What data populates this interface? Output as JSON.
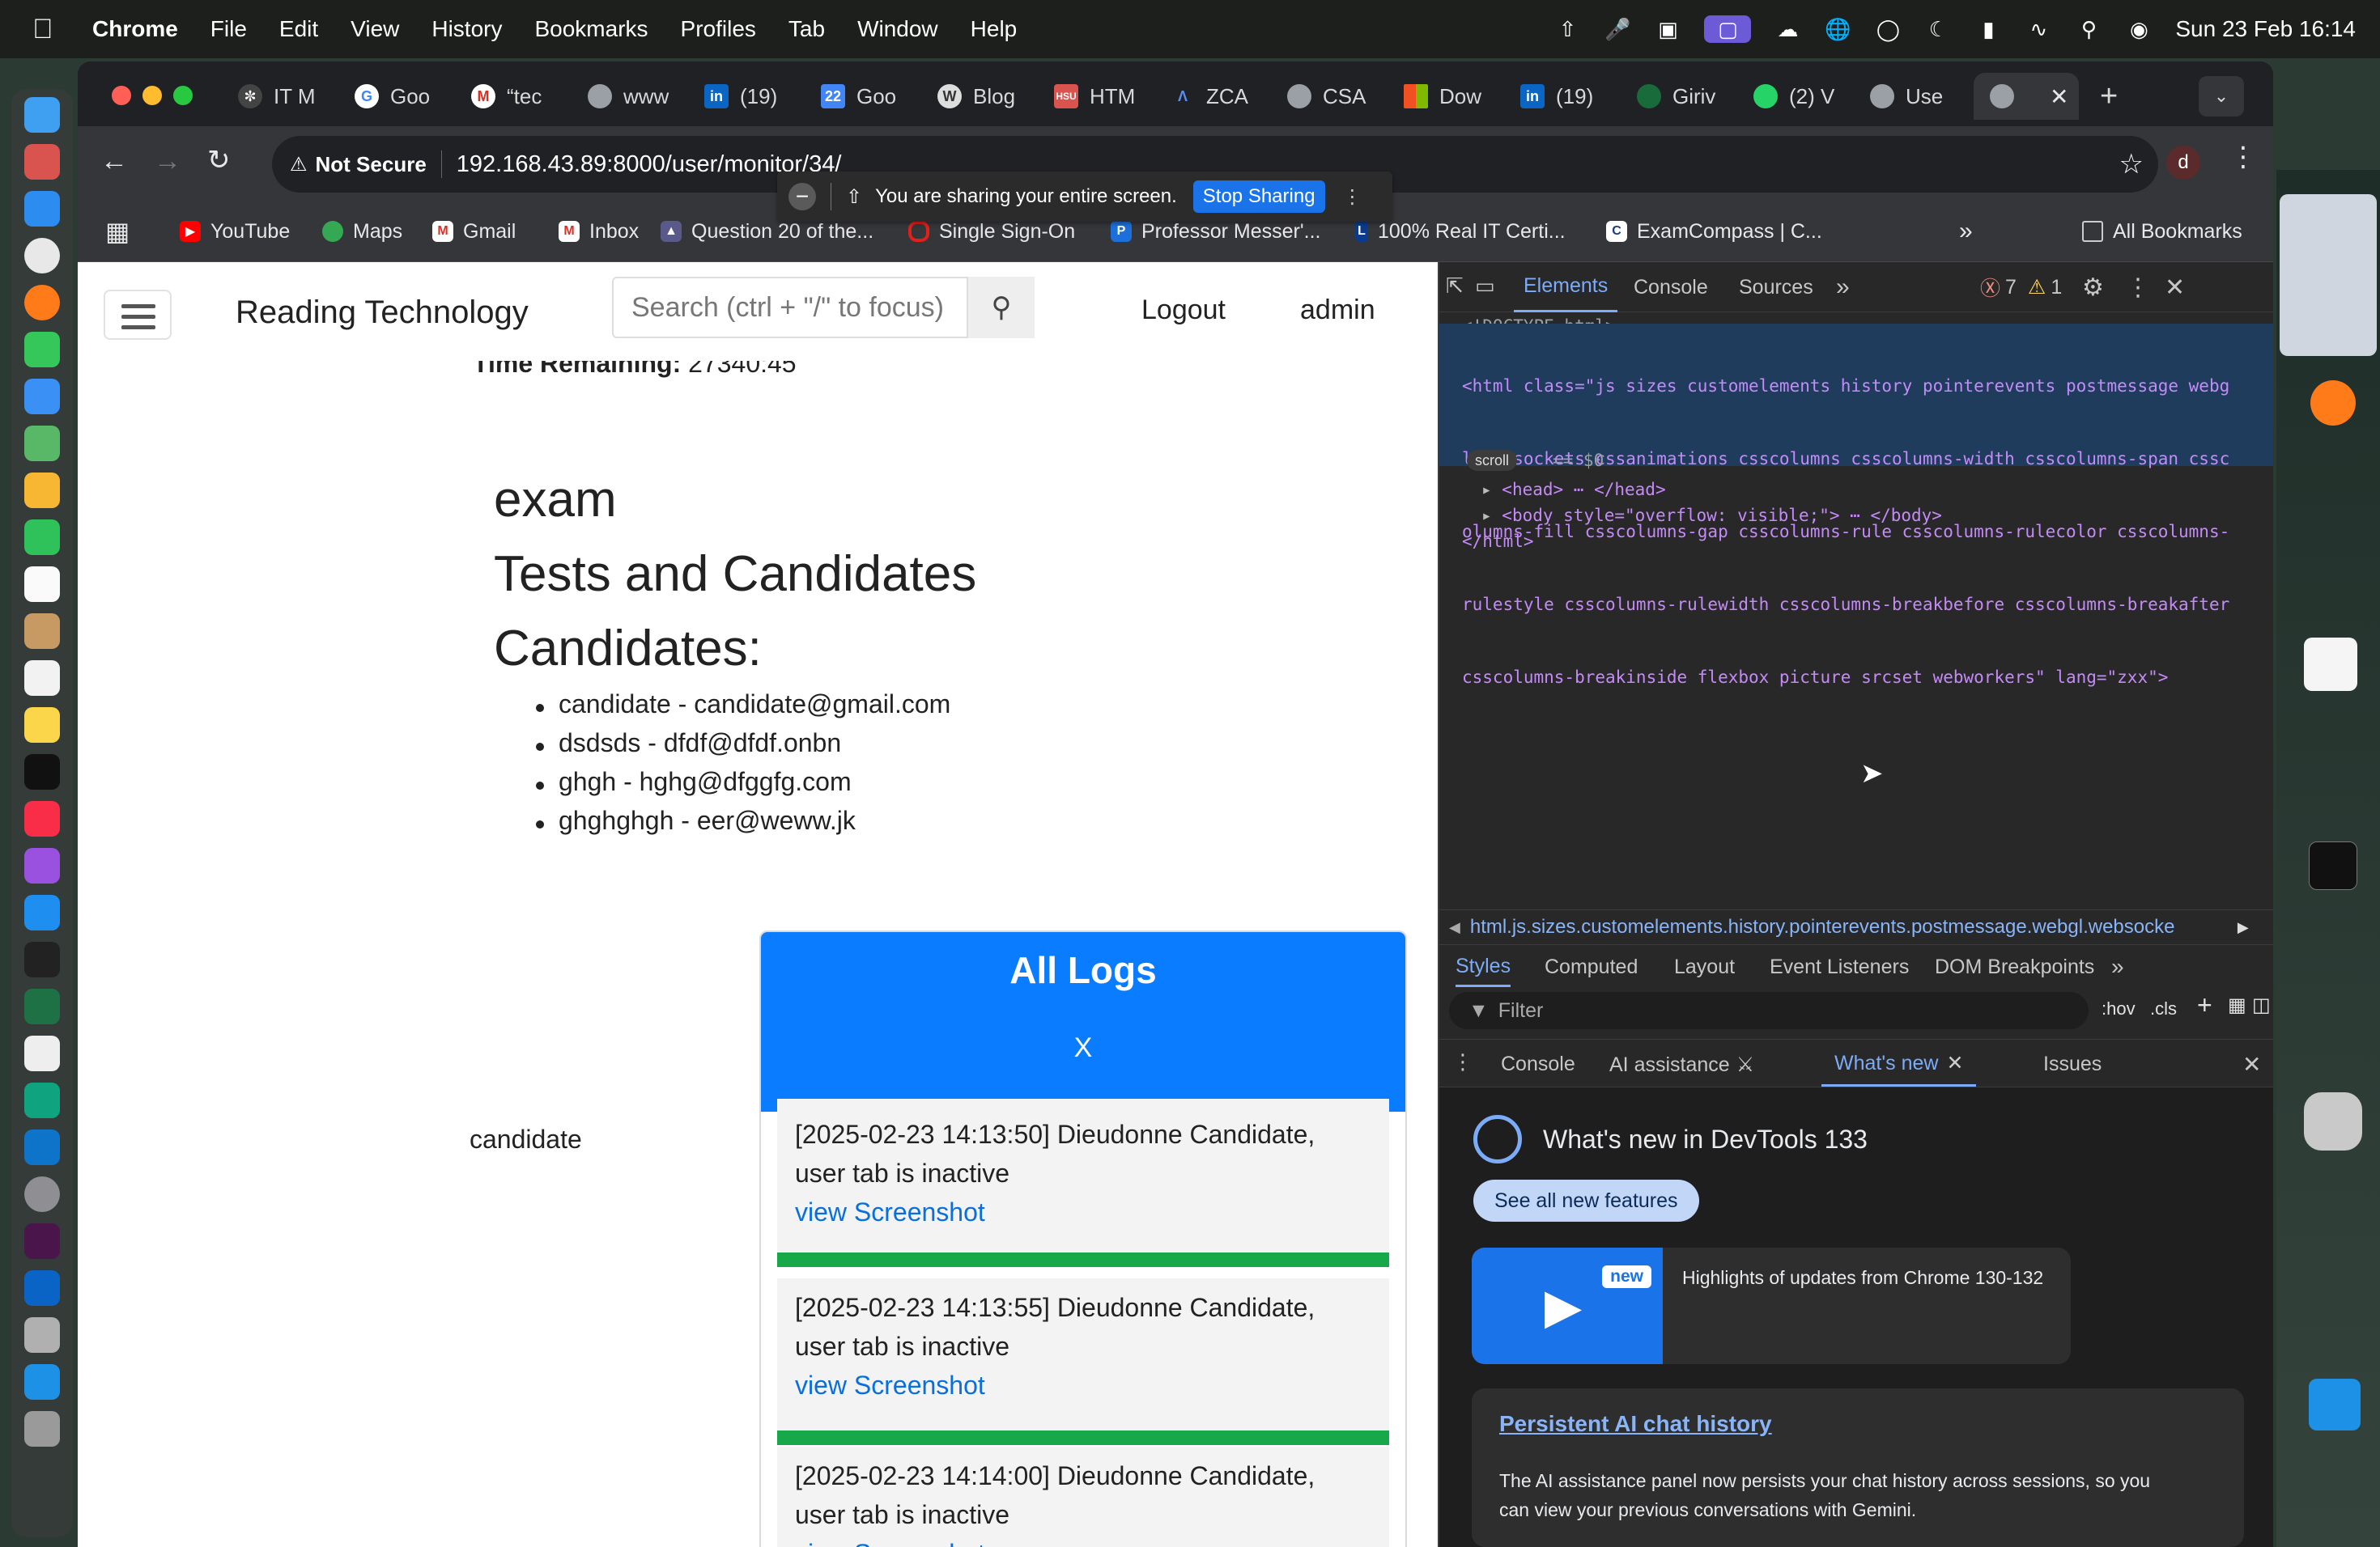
{
  "menubar": {
    "app": "Chrome",
    "items": [
      "File",
      "Edit",
      "View",
      "History",
      "Bookmarks",
      "Profiles",
      "Tab",
      "Window",
      "Help"
    ],
    "clock": "Sun 23 Feb  16:14"
  },
  "tabs": [
    {
      "label": "IT M"
    },
    {
      "label": "Goo"
    },
    {
      "label": "“tec"
    },
    {
      "label": "www"
    },
    {
      "label": "(19)"
    },
    {
      "label": "Goo"
    },
    {
      "label": "Blog"
    },
    {
      "label": "HTM"
    },
    {
      "label": "ZCA"
    },
    {
      "label": "CSA"
    },
    {
      "label": "Dow"
    },
    {
      "label": "(19)"
    },
    {
      "label": "Giriv"
    },
    {
      "label": "(2) V"
    },
    {
      "label": "Use"
    }
  ],
  "omnibox": {
    "security": "Not Secure",
    "url": "192.168.43.89:8000/user/monitor/34/",
    "profile": "d"
  },
  "bookmarks": {
    "items": [
      "YouTube",
      "Maps",
      "Gmail",
      "Inbox",
      "Question 20 of the...",
      "Single Sign-On",
      "Professor Messer'...",
      "100% Real IT Certi...",
      "ExamCompass | C..."
    ],
    "all": "All Bookmarks"
  },
  "sharebar": {
    "message": "You are sharing your entire screen.",
    "stop": "Stop Sharing"
  },
  "site": {
    "brand": "Reading Technology",
    "search_placeholder": "Search (ctrl + \"/\" to focus)",
    "logout": "Logout",
    "user": "admin",
    "time_label": "Time Remaining:",
    "time_value": "27340:45",
    "heading_exam": "exam",
    "heading_tests": "Tests and Candidates",
    "heading_candidates": "Candidates:",
    "candidates": [
      "candidate - candidate@gmail.com",
      "dsdsds - dfdf@dfdf.onbn",
      "ghgh - hghg@dfggfg.com",
      "ghghghgh - eer@weww.jk"
    ],
    "row_label": "candidate",
    "logs_title": "All Logs",
    "logs_close": "X",
    "logs": [
      {
        "text": "[2025-02-23 14:13:50] Dieudonne Candidate, user tab is inactive",
        "link": "view Screenshot"
      },
      {
        "text": "[2025-02-23 14:13:55] Dieudonne Candidate, user tab is inactive",
        "link": "view Screenshot"
      },
      {
        "text": "[2025-02-23 14:14:00] Dieudonne Candidate, user tab is inactive",
        "link": "view Screenshot"
      }
    ]
  },
  "devtools": {
    "tabs": [
      "Elements",
      "Console",
      "Sources"
    ],
    "errors": "7",
    "warnings": "1",
    "doctype": "<!DOCTYPE html>",
    "html_lines": [
      "<html class=\"js sizes customelements history pointerevents postmessage webg",
      "l websockets cssanimations csscolumns csscolumns-width csscolumns-span cssc",
      "olumns-fill csscolumns-gap csscolumns-rule csscolumns-rulecolor csscolumns-",
      "rulestyle csscolumns-rulewidth csscolumns-breakbefore csscolumns-breakafter",
      "csscolumns-breakinside flexbox picture srcset webworkers\" lang=\"zxx\">"
    ],
    "scroll_badge": "scroll",
    "dollar_zero": "== $0",
    "head_line": "<head> ⋯ </head>",
    "body_line": "<body style=\"overflow: visible;\"> ⋯ </body>",
    "html_close": "</html>",
    "breadcrumb": "html.js.sizes.customelements.history.pointerevents.postmessage.webgl.websocke",
    "subtabs": [
      "Styles",
      "Computed",
      "Layout",
      "Event Listeners",
      "DOM Breakpoints"
    ],
    "filter_placeholder": "Filter",
    "hov": ":hov",
    "cls": ".cls",
    "drawer_tabs": [
      "Console",
      "AI assistance",
      "What's new",
      "Issues"
    ],
    "whats_new_title": "What's new in DevTools 133",
    "see_all": "See all new features",
    "new_badge": "new",
    "highlights": "Highlights of updates from Chrome 130-132",
    "feature_title": "Persistent AI chat history",
    "feature_text_1": "The AI assistance panel now persists your chat history across sessions, so you",
    "feature_text_2": "can view your previous conversations with Gemini."
  },
  "colors": {
    "accent_blue": "#0a7cff",
    "log_separator_green": "#17a84a",
    "link_blue": "#0a6fdc",
    "devtools_active": "#7cacf8"
  }
}
